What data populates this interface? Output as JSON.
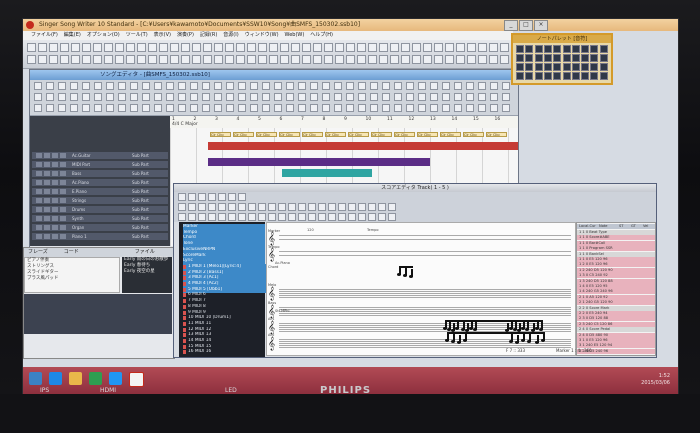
{
  "window": {
    "title": "Singer Song Writer 10 Standard - [C:¥Users¥kawamoto¥Documents¥SSW10¥Song¥曲SMFS_150302.ssb10]",
    "buttons": [
      "_",
      "□",
      "×"
    ]
  },
  "menubar": [
    "ファイル(F)",
    "編集(E)",
    "オプション(O)",
    "ツール(T)",
    "表示(V)",
    "演奏(P)",
    "記録(R)",
    "音源(I)",
    "ウィンドウ(W)",
    "Web(W)",
    "ヘルプ(H)"
  ],
  "song_editor": {
    "title": "ソングエディタ - [曲SMFS_150302.ssb10]",
    "ruler": [
      "1",
      "2",
      "3",
      "4",
      "5",
      "6",
      "7",
      "8",
      "9",
      "10",
      "11",
      "12",
      "13",
      "14",
      "15",
      "16"
    ],
    "tempo_label": "4/4 C Major",
    "tracks": [
      {
        "name": "Ac.Guitar",
        "patch": "Sub Part"
      },
      {
        "name": "MIDI Part",
        "patch": "Sub Part"
      },
      {
        "name": "Bass",
        "patch": "Sub Part"
      },
      {
        "name": "Ac.Piano",
        "patch": "Sub Part"
      },
      {
        "name": "E.Piano",
        "patch": "Sub Part"
      },
      {
        "name": "Strings",
        "patch": "Sub Part"
      },
      {
        "name": "Drums",
        "patch": "Sub Part"
      },
      {
        "name": "Synth",
        "patch": "Sub Part"
      },
      {
        "name": "Organ",
        "patch": "Sub Part"
      },
      {
        "name": "Piano 1",
        "patch": "Sub Part"
      }
    ],
    "clip_label": "Clr Clip"
  },
  "note_palette": {
    "title": "ノートパレット [音符]"
  },
  "file_panel": {
    "tabs": [
      "フレーズ",
      "コード",
      "ファイル"
    ],
    "list": [
      "ピアノ伴奏",
      "ストリングス",
      "スライドギター",
      "ブラス風パッド"
    ],
    "files": [
      "Early 雨の日のお散歩",
      "Early 春待ち",
      "Early 夜空の星"
    ]
  },
  "score_editor": {
    "title": "スコアエディタ Track( 1 - 5 )",
    "tracks": [
      {
        "label": "Marker",
        "hl": true
      },
      {
        "label": "Tempo",
        "hl": true
      },
      {
        "label": "Chord",
        "hl": true
      },
      {
        "label": "Tone",
        "hl": true
      },
      {
        "label": "ExclusiveNRPN",
        "hl": true
      },
      {
        "label": "ScoreMark",
        "hl": true
      },
      {
        "label": "Lyric",
        "hl": true
      },
      {
        "label": "1 MIDI 1 [Melo1][Lyric:4]",
        "hl": true
      },
      {
        "label": "2 MIDI 2 [Bass1]",
        "hl": true
      },
      {
        "label": "3 MIDI 3 [Ac1]",
        "hl": true
      },
      {
        "label": "4 MIDI 4 [Ac2]",
        "hl": true
      },
      {
        "label": "5 MIDI 5 [Obb1]",
        "hl": true
      },
      {
        "label": "6 MIDI 6",
        "hl": false
      },
      {
        "label": "7 MIDI 7",
        "hl": false
      },
      {
        "label": "8 MIDI 8",
        "hl": false
      },
      {
        "label": "9 MIDI 9",
        "hl": false
      },
      {
        "label": "10 MIDI 10 [Drum1]",
        "hl": false
      },
      {
        "label": "11 MIDI 11",
        "hl": false
      },
      {
        "label": "12 MIDI 12",
        "hl": false
      },
      {
        "label": "13 MIDI 13",
        "hl": false
      },
      {
        "label": "14 MIDI 14",
        "hl": false
      },
      {
        "label": "15 MIDI 15",
        "hl": false
      },
      {
        "label": "16 MIDI 16",
        "hl": false
      }
    ],
    "staff_rows": [
      "Marker",
      "Tempo",
      "Chord",
      "Melo",
      "Bass",
      "Ac1",
      "Ac2"
    ],
    "staff_mini_labels": [
      "120",
      "Tempo",
      "Ac.Piano",
      "Str MPhi"
    ],
    "status": "F 7 :: 333",
    "marker_pos": "Marker 1 : 4 : 360"
  },
  "event_list": {
    "headers": [
      "Local.Cur",
      "Note",
      "ST",
      "GT",
      "Vel"
    ],
    "rows": [
      {
        "cls": "grey",
        "text": "1  1  0  Beat Type"
      },
      {
        "cls": "pink",
        "text": "1  1  0  Score#ABE"
      },
      {
        "cls": "pink",
        "text": "1  1  0  Bar#Coll"
      },
      {
        "cls": "pink",
        "text": "1  1  0  Program  SSR"
      },
      {
        "cls": "grey",
        "text": "1  1  0  BankSel"
      },
      {
        "cls": "pink",
        "text": "1  1  0  E5  120  96"
      },
      {
        "cls": "pink",
        "text": "1  2  0  E5  120  96"
      },
      {
        "cls": "pink",
        "text": "1  2  240  D5  120  90"
      },
      {
        "cls": "pink",
        "text": "1  3  0  C5  240  92"
      },
      {
        "cls": "pink",
        "text": "1  3  240  D5  120  88"
      },
      {
        "cls": "pink",
        "text": "1  4  0  E5  120  95"
      },
      {
        "cls": "pink",
        "text": "1  4  240  G5  240  96"
      },
      {
        "cls": "pink",
        "text": "2  1  0  A5  120  92"
      },
      {
        "cls": "pink",
        "text": "2  1  240  G5  120  90"
      },
      {
        "cls": "grey",
        "text": "2  2  0  Score Mark"
      },
      {
        "cls": "pink",
        "text": "2  2  0  E5  240  94"
      },
      {
        "cls": "pink",
        "text": "2  3  0  D5  120  88"
      },
      {
        "cls": "pink",
        "text": "2  3  240  C5  120  86"
      },
      {
        "cls": "grey",
        "text": "2  4  0  Score Pedal"
      },
      {
        "cls": "pink",
        "text": "2  4  0  D5  480  90"
      },
      {
        "cls": "pink",
        "text": "3  1  0  E5  120  96"
      },
      {
        "cls": "pink",
        "text": "3  1  240  E5  120  94"
      },
      {
        "cls": "pink",
        "text": "3  2  0  G5  240  96"
      }
    ]
  },
  "taskbar": {
    "time": "1:52",
    "date": "2015/03/06"
  },
  "monitor": {
    "brand": "PHILIPS",
    "badges": [
      "IPS",
      "HDMI",
      "LED"
    ]
  }
}
